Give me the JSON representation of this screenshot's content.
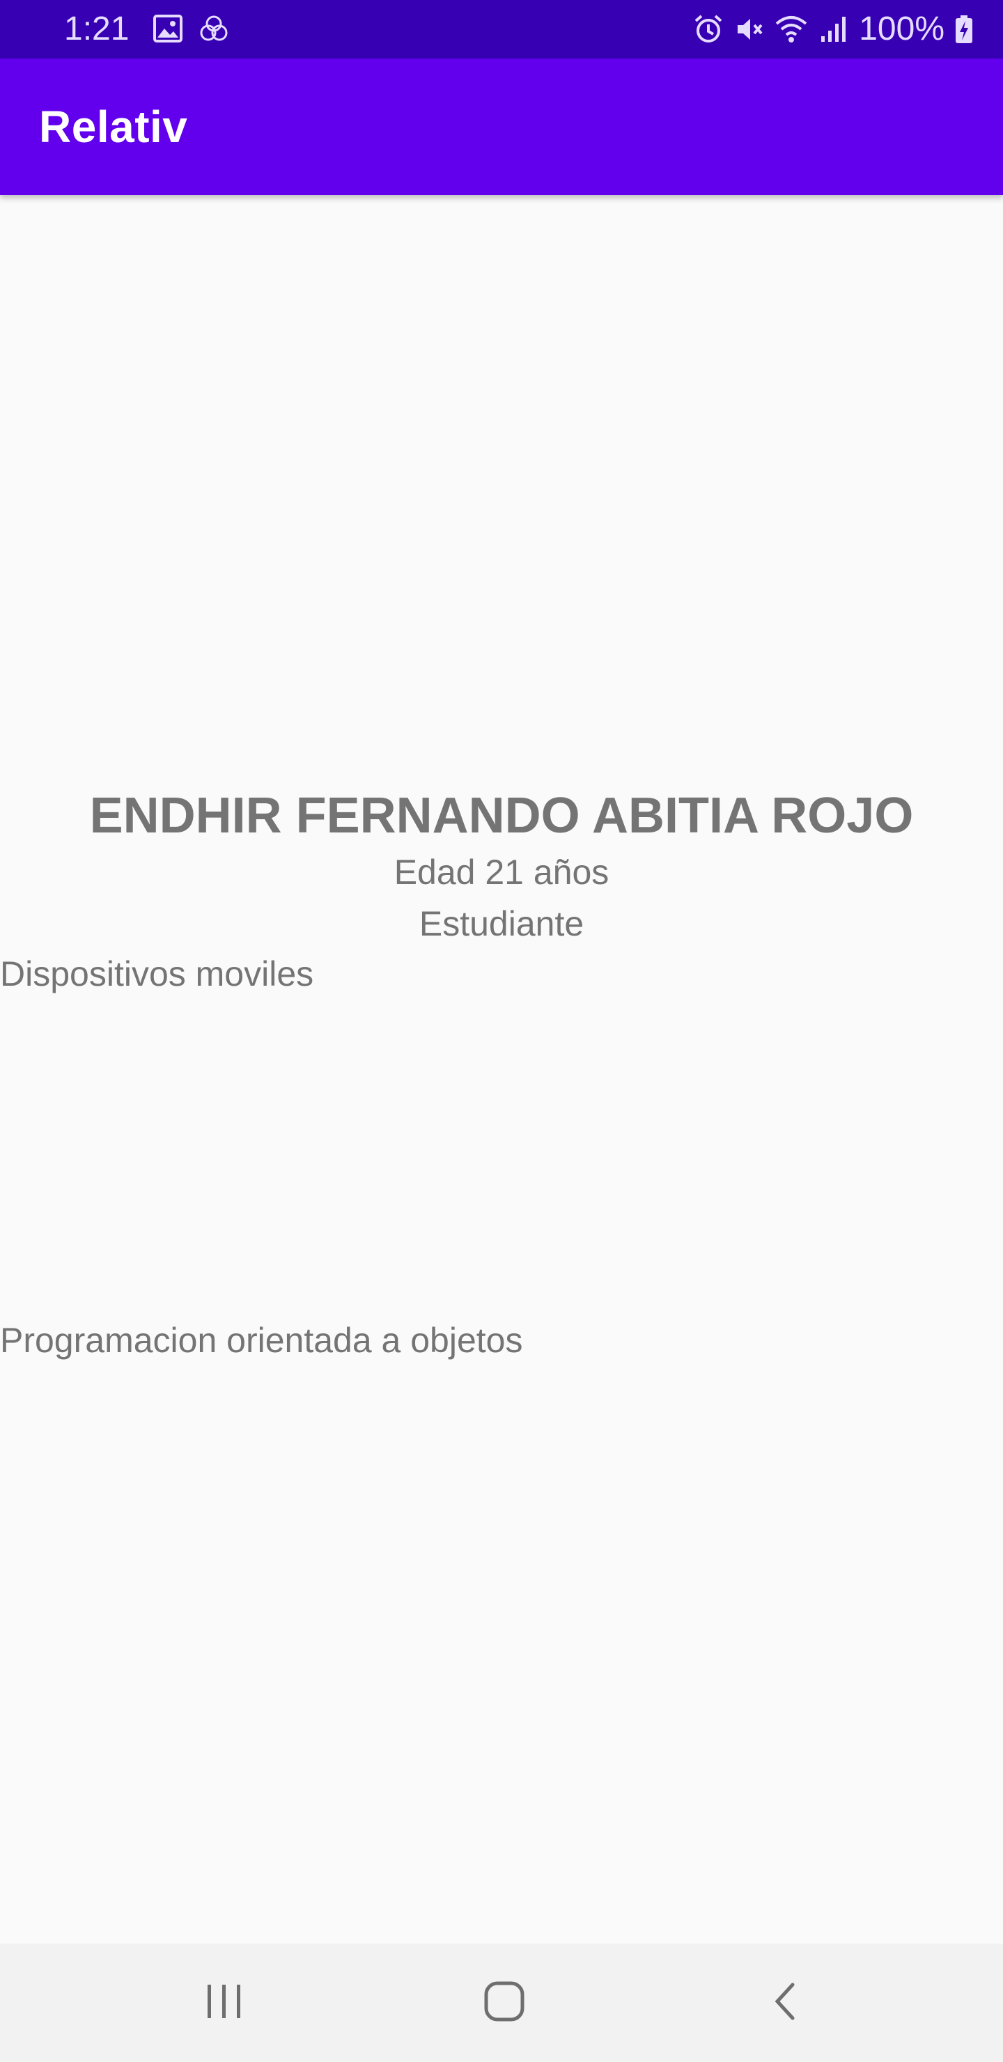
{
  "status_bar": {
    "time": "1:21",
    "battery": "100%",
    "icons": [
      "image-icon",
      "circles-icon",
      "alarm-icon",
      "mute-icon",
      "wifi-icon",
      "signal-icon",
      "battery-charging-icon"
    ]
  },
  "app_bar": {
    "title": "Relativ"
  },
  "profile": {
    "name": "ENDHIR FERNANDO ABITIA ROJO",
    "age": "Edad 21 años",
    "role": "Estudiante",
    "courses": [
      "Dispositivos moviles",
      "Programacion orientada a objetos"
    ]
  },
  "nav_bar": {
    "icons": [
      "recents-icon",
      "home-icon",
      "back-icon"
    ]
  },
  "colors": {
    "status_bar": "#3700b3",
    "app_bar": "#6200ee",
    "background": "#fafafa",
    "text": "#747474"
  }
}
